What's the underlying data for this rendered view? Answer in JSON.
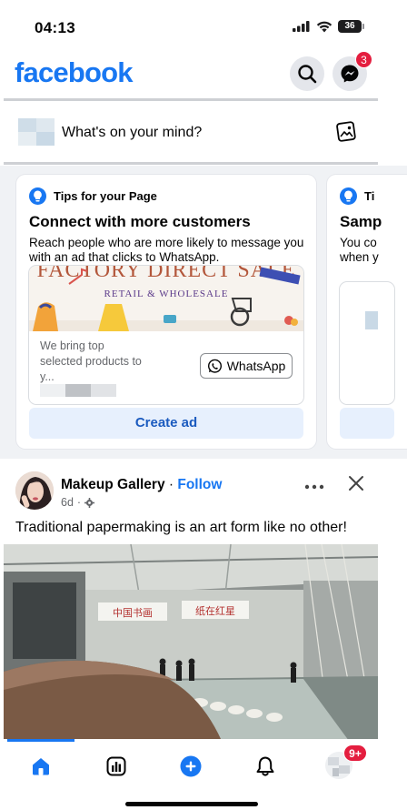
{
  "status_bar": {
    "time": "04:13",
    "battery": "36"
  },
  "header": {
    "logo": "facebook",
    "search_icon": "search-icon",
    "messenger_icon": "messenger-icon",
    "messenger_badge": "3"
  },
  "composer": {
    "placeholder": "What's on your mind?",
    "photo_icon": "photo-icon"
  },
  "tips": [
    {
      "label": "Tips for your Page",
      "title": "Connect with more customers",
      "description": "Reach people who are more likely to message you with an ad that clicks to WhatsApp.",
      "ad_preview": {
        "headline": "FACTORY DIRECT SALE",
        "subheadline": "RETAIL & WHOLESALE",
        "body": "We bring top selected products to y...",
        "button": "WhatsApp"
      },
      "cta": "Create ad"
    },
    {
      "label": "Ti",
      "title": "Samp",
      "description_lines": [
        "You co",
        "when y"
      ]
    }
  ],
  "post": {
    "author": "Makeup Gallery",
    "separator": "·",
    "follow": "Follow",
    "time": "6d",
    "audience_icon": "gear-icon",
    "text": "Traditional papermaking is an art form like no other!",
    "banner_left": "中国书画",
    "banner_right": "纸在红星"
  },
  "bottom_nav": {
    "items": [
      {
        "name": "home",
        "icon": "home-icon",
        "active": true
      },
      {
        "name": "dashboard",
        "icon": "dashboard-icon",
        "active": false
      },
      {
        "name": "create",
        "icon": "plus-icon",
        "active": false
      },
      {
        "name": "notifications",
        "icon": "bell-icon",
        "active": false
      },
      {
        "name": "profile",
        "icon": "avatar",
        "active": false
      }
    ],
    "profile_badge": "9+"
  },
  "colors": {
    "brand": "#1877f2",
    "badge": "#e41e3f",
    "text": "#050505",
    "secondary": "#65676b",
    "divider": "#ced0d4"
  }
}
